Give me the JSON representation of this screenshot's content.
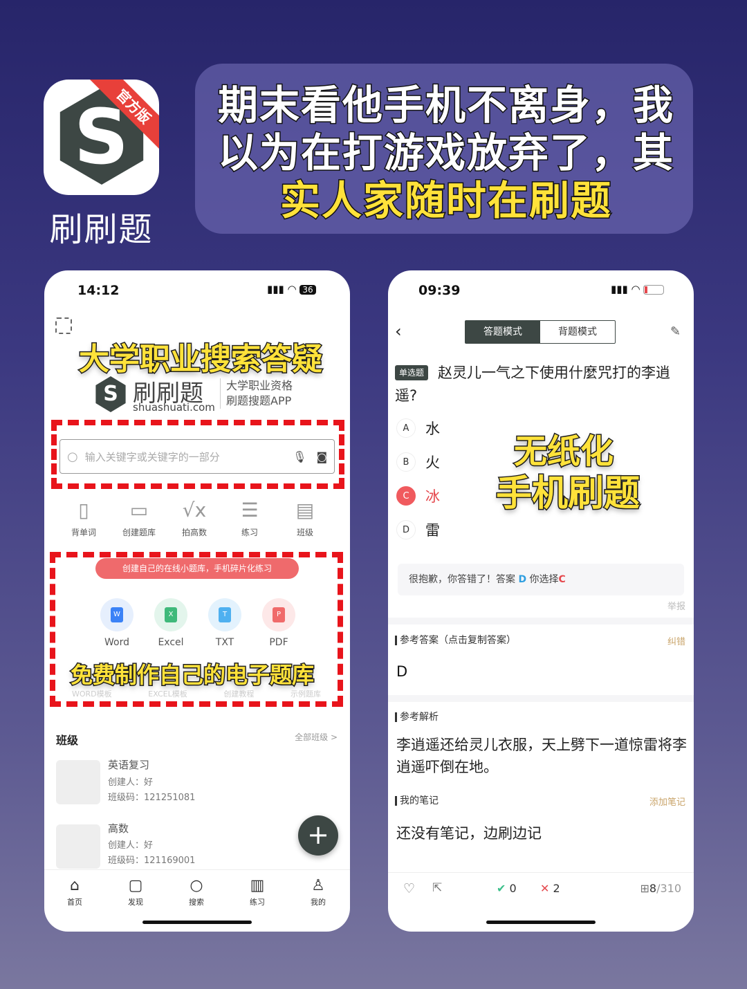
{
  "banner": {
    "app_name": "刷刷题",
    "ribbon": "官方版",
    "headline_lines": [
      "期末看他手机不离身，我",
      "以为在打游戏放弃了，其"
    ],
    "headline_highlight": "实人家随时在刷题"
  },
  "left_phone": {
    "status": {
      "time": "14:12",
      "battery": "36"
    },
    "caption_top": "大学职业搜索答疑",
    "logo": {
      "name": "刷刷题",
      "domain": "shuashuati.com",
      "slogan_1": "大学职业资格",
      "slogan_2": "刷题搜题APP"
    },
    "search": {
      "placeholder": "输入关键字或关键字的一部分"
    },
    "tools": [
      {
        "label": "背单词",
        "icon": "vocab-card-icon"
      },
      {
        "label": "创建题库",
        "icon": "create-bank-icon"
      },
      {
        "label": "拍高数",
        "icon": "sqrt-icon"
      },
      {
        "label": "练习",
        "icon": "practice-icon"
      },
      {
        "label": "班级",
        "icon": "class-icon"
      }
    ],
    "banner_pill": "创建自己的在线小题库，手机碎片化练习",
    "formats": [
      {
        "label": "Word",
        "letter": "W",
        "color": "#3b82f6"
      },
      {
        "label": "Excel",
        "letter": "X",
        "color": "#3fb97a"
      },
      {
        "label": "TXT",
        "letter": "T",
        "color": "#4fb0f0"
      },
      {
        "label": "PDF",
        "letter": "P",
        "color": "#f06a6a"
      }
    ],
    "caption_mid": "免费制作自己的电子题库",
    "template_links": [
      "WORD模板",
      "EXCEL模板",
      "创建教程",
      "示例题库"
    ],
    "classes": {
      "title": "班级",
      "all_link": "全部班级 >",
      "items": [
        {
          "name": "英语复习",
          "creator": "创建人：好",
          "code": "班级码：121251081"
        },
        {
          "name": "高数",
          "creator": "创建人：好",
          "code": "班级码：121169001"
        }
      ]
    },
    "tabs": [
      {
        "label": "首页",
        "icon": "home-icon"
      },
      {
        "label": "发现",
        "icon": "discover-icon"
      },
      {
        "label": "搜索",
        "icon": "search-icon"
      },
      {
        "label": "练习",
        "icon": "book-icon"
      },
      {
        "label": "我的",
        "icon": "profile-icon"
      }
    ]
  },
  "right_phone": {
    "status": {
      "time": "09:39"
    },
    "modes": [
      "答题模式",
      "背题模式"
    ],
    "question": {
      "type": "单选题",
      "text": "赵灵儿一气之下使用什麼咒打的李逍遥?"
    },
    "options": [
      {
        "letter": "A",
        "text": "水"
      },
      {
        "letter": "B",
        "text": "火"
      },
      {
        "letter": "C",
        "text": "冰"
      },
      {
        "letter": "D",
        "text": "雷"
      }
    ],
    "caption_1": "无纸化",
    "caption_2": "手机刷题",
    "feedback": {
      "prefix": "很抱歉，你答错了！答案",
      "answer": "D",
      "mid": "你选择",
      "chosen": "C"
    },
    "report": "举报",
    "ref_answer": {
      "title": "参考答案（点击复制答案）",
      "action": "纠错",
      "value": "D"
    },
    "analysis": {
      "title": "参考解析",
      "text": "李逍遥还给灵儿衣服，天上劈下一道惊雷将李逍遥吓倒在地。"
    },
    "notes": {
      "title": "我的笔记",
      "action": "添加笔记",
      "empty": "还没有笔记，边刷边记"
    },
    "footer": {
      "correct": "0",
      "wrong": "2",
      "current": "8",
      "total": "/310"
    },
    "colors": {
      "correct": "#3bbf8a",
      "wrong": "#e5484d",
      "answer_blue": "#2f9ee0",
      "accent_gold": "#c9a46a"
    }
  }
}
